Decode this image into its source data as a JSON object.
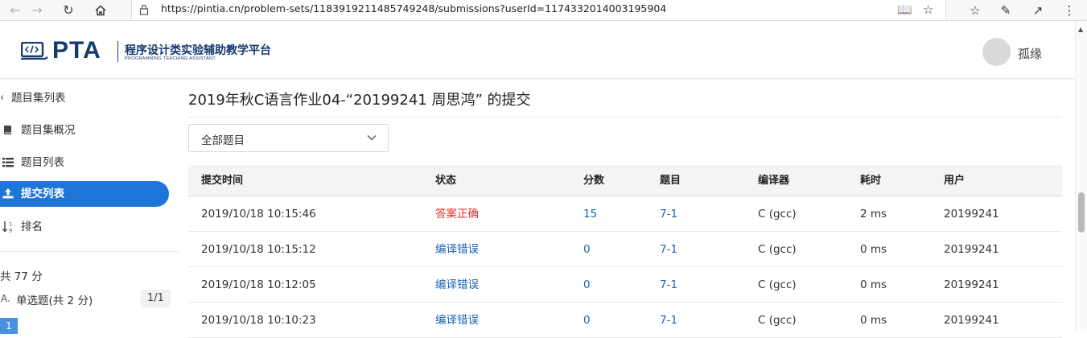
{
  "browser": {
    "url": "https://pintia.cn/problem-sets/1183919211485749248/submissions?userId=1174332014003195904"
  },
  "header": {
    "logo_text": "PTA",
    "logo_cn": "程序设计类实验辅助教学平台",
    "logo_en": "PROGRAMMING TEACHING ASSISTANT",
    "username": "孤缘"
  },
  "sidebar": {
    "back_label": "题目集列表",
    "items": [
      {
        "label": "题目集概况",
        "icon": "book-icon"
      },
      {
        "label": "题目列表",
        "icon": "list-icon"
      },
      {
        "label": "提交列表",
        "icon": "upload-icon",
        "active": true
      },
      {
        "label": "排名",
        "icon": "sort-numeric-icon"
      }
    ],
    "total": "共 77 分",
    "category": {
      "label": "单选题(共 2 分)",
      "count": "1/1"
    },
    "question_number": "1"
  },
  "main": {
    "title": "2019年秋C语言作业04-“20199241 周思鸿” 的提交",
    "filter": {
      "value": "全部题目"
    },
    "table": {
      "headers": [
        "提交时间",
        "状态",
        "分数",
        "题目",
        "编译器",
        "耗时",
        "用户"
      ],
      "rows": [
        {
          "time": "2019/10/18 10:15:46",
          "status": "答案正确",
          "score": "15",
          "problem": "7-1",
          "compiler": "C (gcc)",
          "duration": "2 ms",
          "user": "20199241"
        },
        {
          "time": "2019/10/18 10:15:12",
          "status": "编译错误",
          "score": "0",
          "problem": "7-1",
          "compiler": "C (gcc)",
          "duration": "0 ms",
          "user": "20199241"
        },
        {
          "time": "2019/10/18 10:12:05",
          "status": "编译错误",
          "score": "0",
          "problem": "7-1",
          "compiler": "C (gcc)",
          "duration": "0 ms",
          "user": "20199241"
        },
        {
          "time": "2019/10/18 10:10:23",
          "status": "编译错误",
          "score": "0",
          "problem": "7-1",
          "compiler": "C (gcc)",
          "duration": "0 ms",
          "user": "20199241"
        }
      ]
    }
  },
  "colors": {
    "accent": "#1d75d8",
    "brand": "#163a6f",
    "status_ok": "#e0302d",
    "status_error": "#1b63b4"
  }
}
